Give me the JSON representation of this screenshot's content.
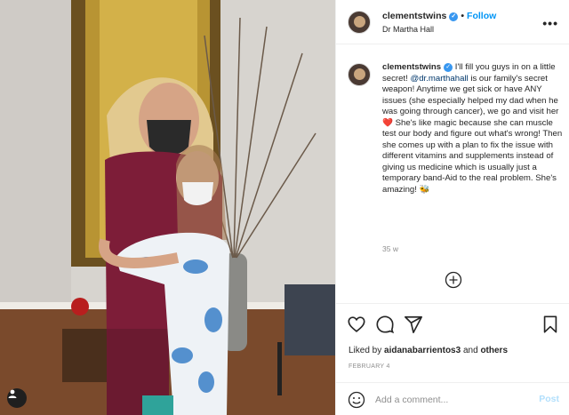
{
  "post": {
    "username": "clementstwins",
    "verified_glyph": "✓",
    "follow_label": "Follow",
    "separator": "•",
    "location": "Dr Martha Hall",
    "more_icon": "more-horizontal-icon"
  },
  "caption": {
    "username": "clementstwins",
    "text_1": " I'll fill you guys in on a little secret! ",
    "mention": "@dr.marthahall",
    "text_2": " is our family's secret weapon! Anytime we get sick or have ANY issues (she especially helped my dad when he was going through cancer), we go and visit her ",
    "emoji_1": "❤️",
    "text_3": " She's like magic because she can muscle test our body and figure out what's wrong! Then she comes up with a plan to fix the issue with different vitamins and supplements instead of giving us medicine which is usually just a temporary band-Aid to the real problem. She's amazing! ",
    "emoji_2": "🐝",
    "timestamp": "35 w"
  },
  "actions": {
    "icons": [
      "heart-icon",
      "comment-icon",
      "share-icon",
      "bookmark-icon"
    ],
    "likes_prefix": "Liked by ",
    "likes_user": "aidanabarrientos3",
    "likes_suffix": " and ",
    "likes_others": "others",
    "date": "FEBRUARY 4"
  },
  "comment_bar": {
    "placeholder": "Add a comment...",
    "post_label": "Post"
  },
  "colors": {
    "link_blue": "#0095f6",
    "mention_blue": "#00376b",
    "muted": "#8e8e8e",
    "post_disabled": "#b2dffc"
  }
}
